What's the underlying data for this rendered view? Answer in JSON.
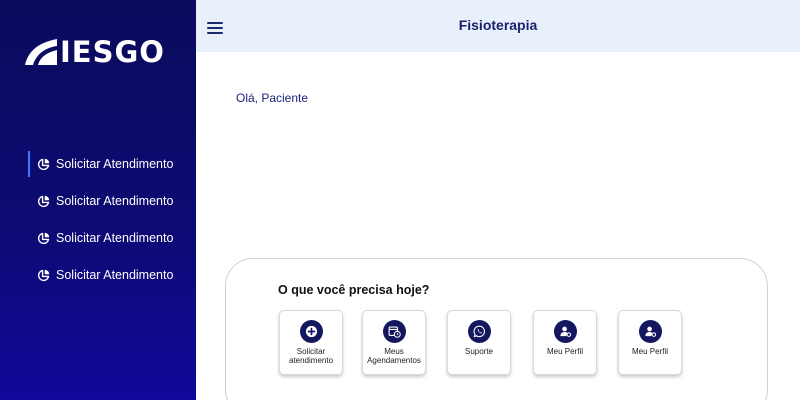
{
  "brand": {
    "name": "IESGO"
  },
  "sidebar": {
    "items": [
      {
        "label": "Solicitar Atendimento",
        "icon": "pie-chart-icon",
        "active": true
      },
      {
        "label": "Solicitar Atendimento",
        "icon": "pie-chart-icon",
        "active": false
      },
      {
        "label": "Solicitar Atendimento",
        "icon": "pie-chart-icon",
        "active": false
      },
      {
        "label": "Solicitar Atendimento",
        "icon": "pie-chart-icon",
        "active": false
      }
    ]
  },
  "header": {
    "title": "Fisioterapia",
    "menu_icon": "hamburger-menu-icon"
  },
  "main": {
    "greeting": "Olá, Paciente",
    "card": {
      "title": "O que você precisa hoje?",
      "actions": [
        {
          "label": "Solicitar atendimento",
          "icon": "plus-circle-icon"
        },
        {
          "label": "Meus Agendamentos",
          "icon": "calendar-clock-icon"
        },
        {
          "label": "Suporte",
          "icon": "whatsapp-icon"
        },
        {
          "label": "Meu Perfil",
          "icon": "user-settings-icon"
        },
        {
          "label": "Meu Perfil",
          "icon": "user-settings-icon"
        }
      ]
    }
  },
  "colors": {
    "sidebar_bg": "#0d0a72",
    "topbar_bg": "#e8f0fb",
    "accent": "#13175e",
    "active_indicator": "#3b7bff"
  }
}
